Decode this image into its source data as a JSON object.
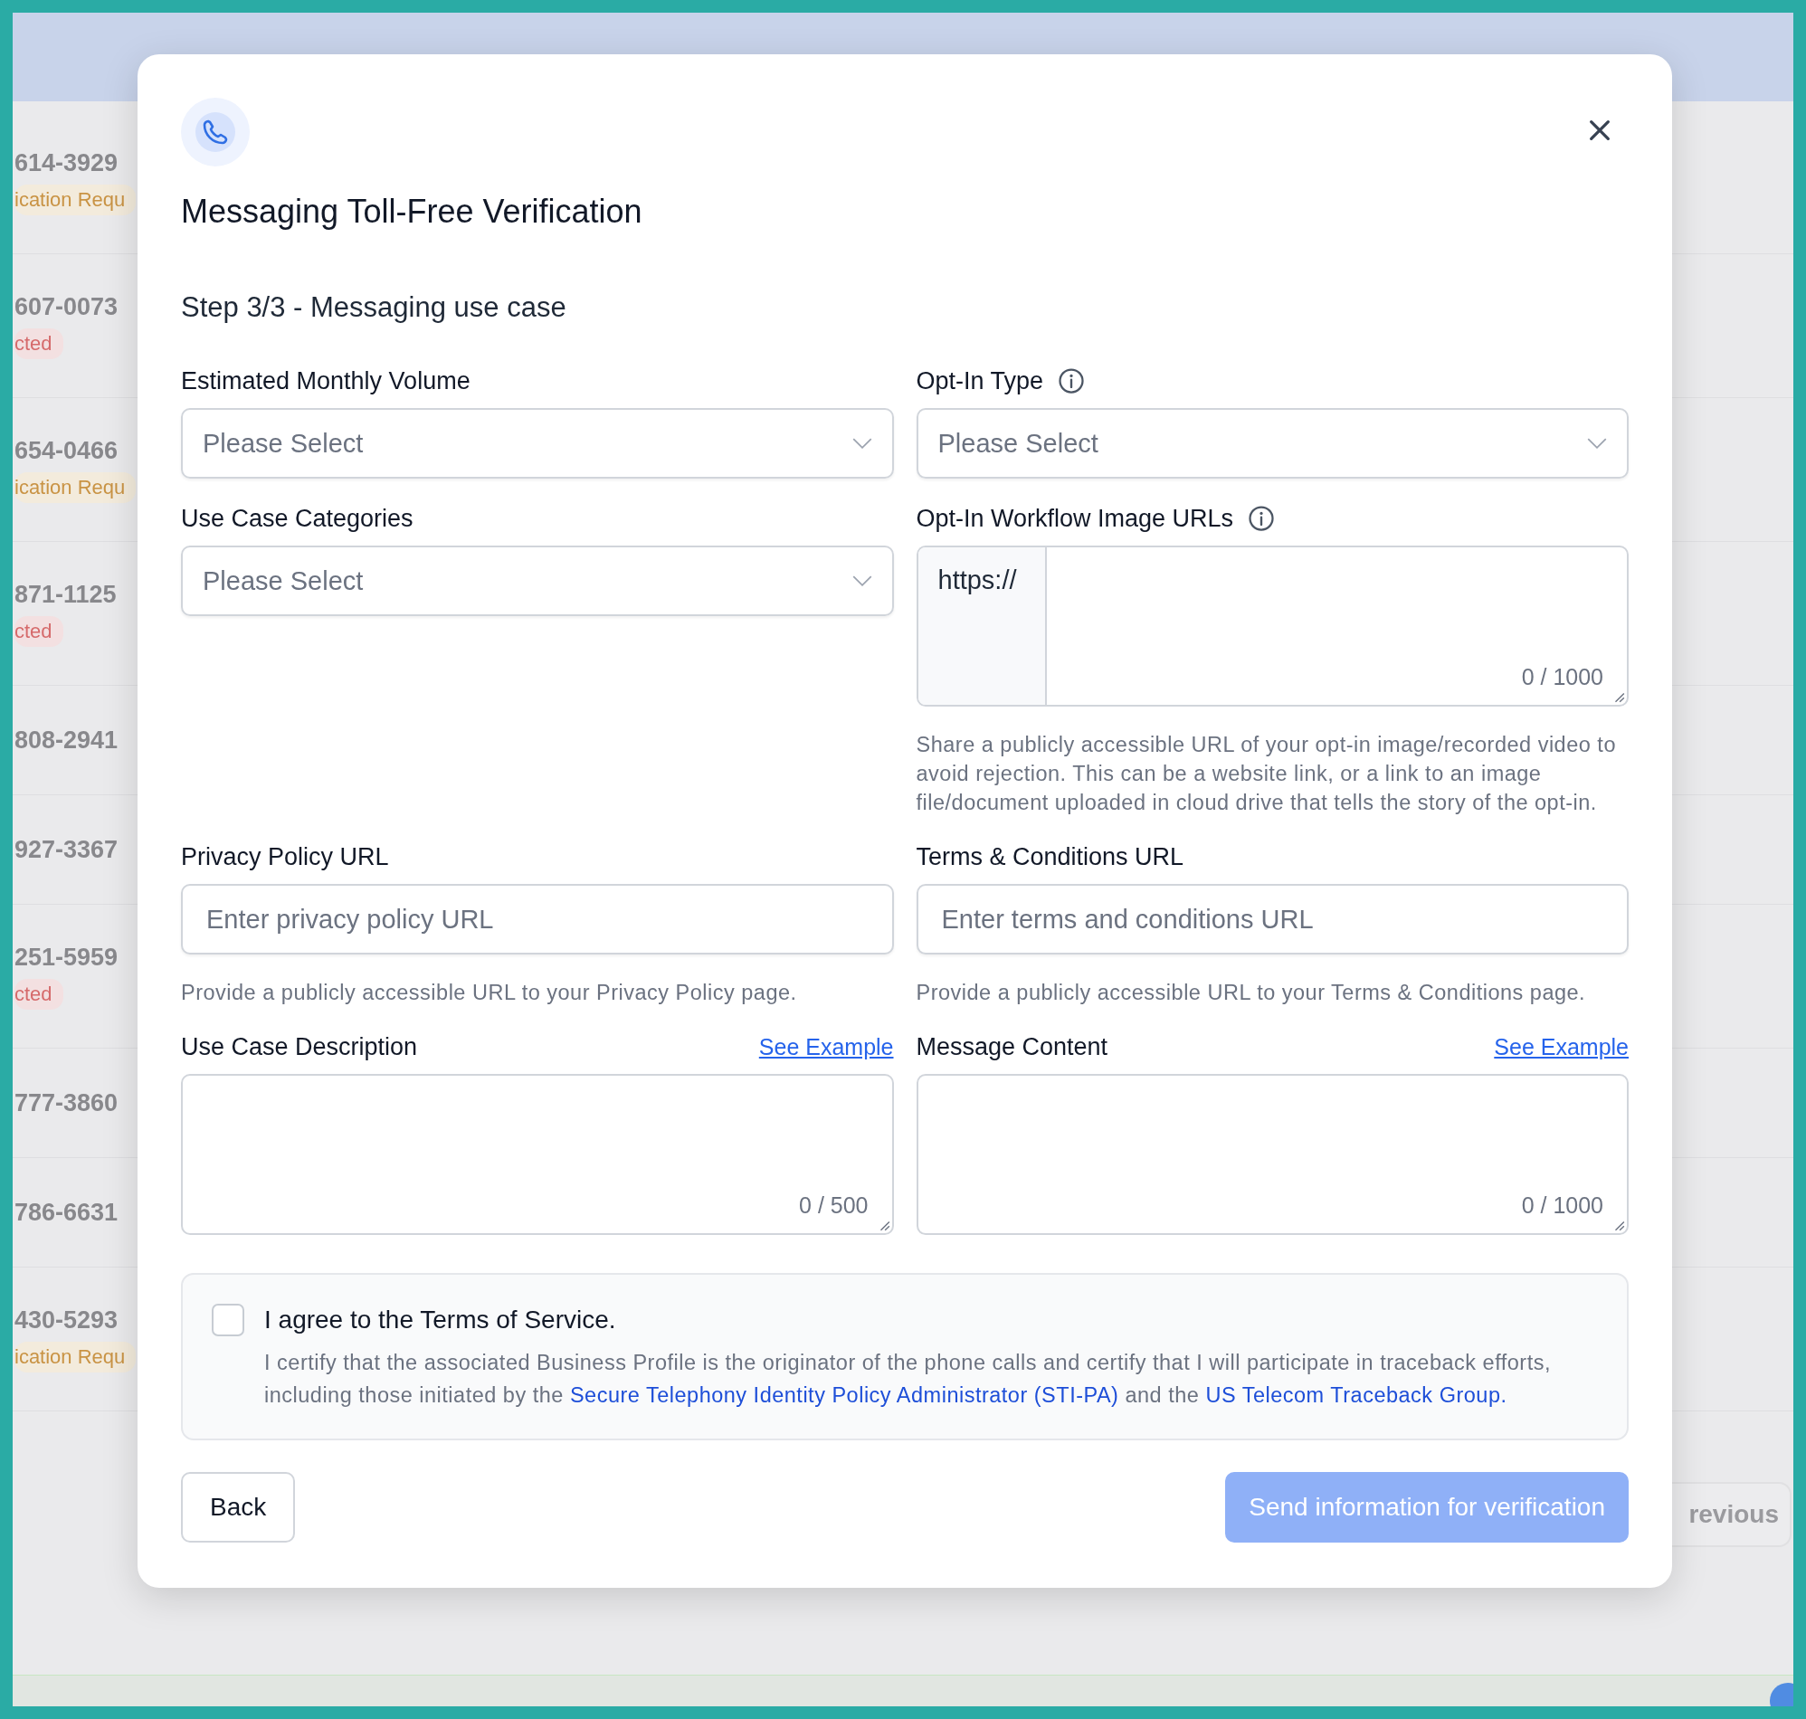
{
  "background": {
    "rows": [
      {
        "number": "614-3929",
        "badge": {
          "text": "ication Requ",
          "kind": "warning"
        }
      },
      {
        "number": "607-0073",
        "badge": {
          "text": "cted",
          "kind": "error"
        }
      },
      {
        "number": "654-0466",
        "badge": {
          "text": "ication Requ",
          "kind": "warning"
        }
      },
      {
        "number": "871-1125",
        "badge": {
          "text": "cted",
          "kind": "error"
        }
      },
      {
        "number": "808-2941"
      },
      {
        "number": "927-3367"
      },
      {
        "number": "251-5959",
        "badge": {
          "text": "cted",
          "kind": "error"
        }
      },
      {
        "number": "777-3860"
      },
      {
        "number": "786-6631"
      },
      {
        "number": "430-5293",
        "badge": {
          "text": "ication Requ",
          "kind": "warning"
        }
      }
    ],
    "pager_button": "revious"
  },
  "modal": {
    "title": "Messaging Toll-Free Verification",
    "step": "Step 3/3 - Messaging use case",
    "rows": [
      {
        "columns": [
          [
            {
              "kind": "select",
              "label": "Estimated Monthly Volume",
              "info": false,
              "placeholder": "Please Select"
            },
            {
              "kind": "select",
              "label": "Use Case Categories",
              "info": false,
              "placeholder": "Please Select"
            }
          ],
          [
            {
              "kind": "select",
              "label": "Opt-In Type",
              "info": true,
              "placeholder": "Please Select"
            },
            {
              "kind": "url_area",
              "label": "Opt-In Workflow Image URLs",
              "info": true,
              "prefix": "https://",
              "counter": "0 / 1000",
              "help": "Share a publicly accessible URL of your opt-in image/recorded video to avoid rejection. This can be a website link, or a link to an image file/document uploaded in cloud drive that tells the story of the opt-in."
            }
          ]
        ]
      },
      {
        "columns": [
          [
            {
              "kind": "input",
              "label": "Privacy Policy URL",
              "info": false,
              "placeholder": "Enter privacy policy URL",
              "help": "Provide a publicly accessible URL to your Privacy Policy page."
            }
          ],
          [
            {
              "kind": "input",
              "label": "Terms & Conditions URL",
              "info": false,
              "placeholder": "Enter terms and conditions URL",
              "help": "Provide a publicly accessible URL to your Terms & Conditions page."
            }
          ]
        ]
      },
      {
        "columns": [
          [
            {
              "kind": "textarea",
              "label": "Use Case Description",
              "info": false,
              "link": "See Example",
              "counter": "0 / 500"
            }
          ],
          [
            {
              "kind": "textarea",
              "label": "Message Content",
              "info": false,
              "link": "See Example",
              "counter": "0 / 1000"
            }
          ]
        ]
      }
    ],
    "agreement": {
      "checked": false,
      "title": "I agree to the Terms of Service.",
      "parts": [
        {
          "kind": "text",
          "text": "I certify that the associated Business Profile is the originator of the phone calls and certify that I will participate in traceback efforts, including those initiated by the"
        },
        {
          "kind": "link",
          "text": "Secure Telephony Identity Policy Administrator (STI-PA)"
        },
        {
          "kind": "text",
          "text": "and the"
        },
        {
          "kind": "link",
          "text": "US Telecom Traceback Group."
        }
      ]
    },
    "back_button": "Back",
    "submit_button": {
      "label": "Send information for verification",
      "disabled": true
    }
  }
}
